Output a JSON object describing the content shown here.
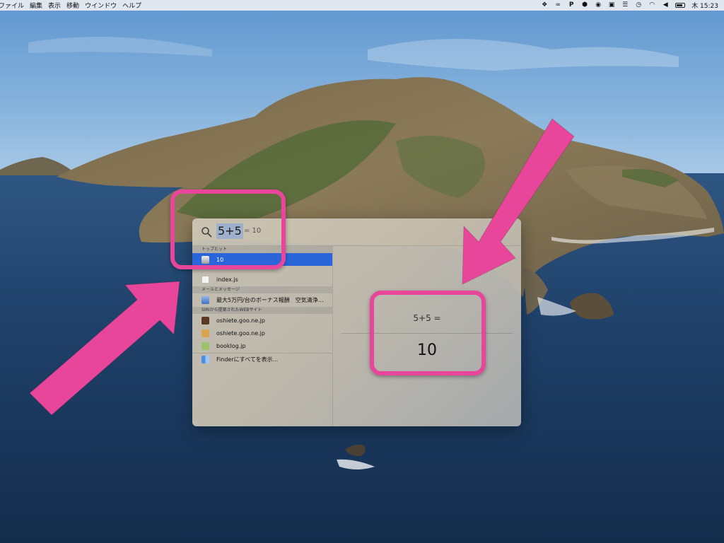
{
  "menubar": {
    "menus": [
      "ファイル",
      "編集",
      "表示",
      "移動",
      "ウインドウ",
      "ヘルプ"
    ],
    "status_icons": [
      "dropbox-icon",
      "creative-cloud-icon",
      "p-icon",
      "shield-icon",
      "1password-icon",
      "screen-icon",
      "menu-icon",
      "time-machine-icon",
      "wifi-icon",
      "volume-icon",
      "battery-icon"
    ],
    "clock": "木 15:23"
  },
  "spotlight": {
    "query": "5+5",
    "inline_result": "= 10",
    "sections": {
      "top_hit": "トップヒット",
      "mail": "メールとメッセージ",
      "siri": "SIRIから提案されたWEBサイト"
    },
    "top_hit": {
      "label": "10",
      "icon": "calculator-icon"
    },
    "other_results": [
      {
        "label": "index.js",
        "icon": "js-file-icon"
      }
    ],
    "mail_results": [
      {
        "label": "最大5万円/台のボーナス報酬　空気清浄…",
        "icon": "mail-icon"
      }
    ],
    "web_results": [
      {
        "label": "oshiete.goo.ne.jp",
        "icon": "goo-favicon"
      },
      {
        "label": "oshiete.goo.ne.jp",
        "icon": "goo-favicon"
      },
      {
        "label": "booklog.jp",
        "icon": "booklog-favicon"
      }
    ],
    "finder_action": {
      "label": "Finderにすべてを表示...",
      "icon": "finder-icon"
    },
    "preview": {
      "expression": "5+5  =",
      "result": "10"
    }
  },
  "annotation_color": "#e8469a"
}
